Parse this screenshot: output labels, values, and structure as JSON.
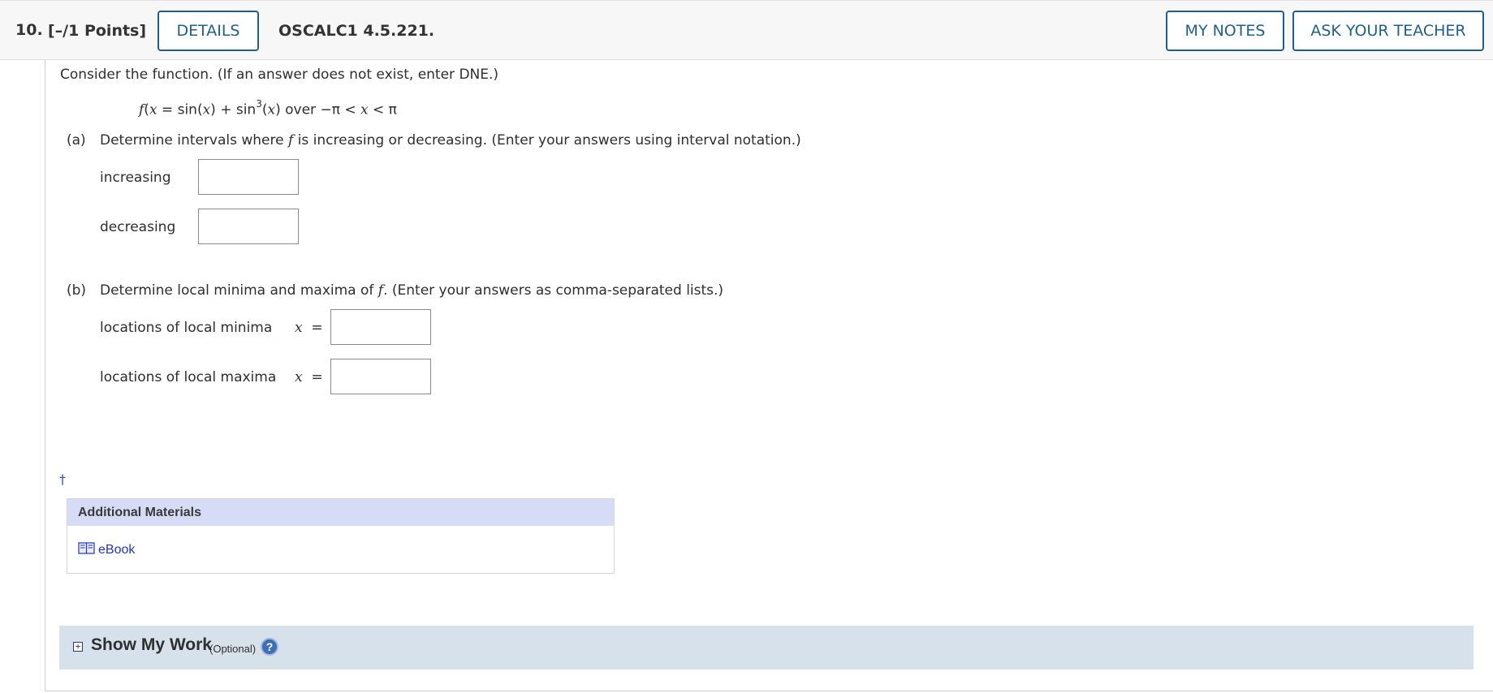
{
  "header": {
    "question_number": "10.",
    "points": "[–/1 Points]",
    "details_label": "DETAILS",
    "problem_code": "OSCALC1 4.5.221.",
    "my_notes_label": "MY NOTES",
    "ask_teacher_label": "ASK YOUR TEACHER"
  },
  "problem": {
    "intro": "Consider the function. (If an answer does not exist, enter DNE.)",
    "function": {
      "f": "f",
      "x1": "x",
      "eq": " = sin(",
      "x2": "x",
      "mid": ") + sin",
      "exp": "3",
      "paren_open": "(",
      "x3": "x",
      "over": ") over −π < ",
      "x4": "x",
      "end": " < π"
    }
  },
  "part_a": {
    "label": "(a)",
    "instruction_pre": "Determine intervals where ",
    "instruction_f": "f",
    "instruction_post": " is increasing or decreasing. (Enter your answers using interval notation.)",
    "increasing_label": "increasing",
    "increasing_value": "",
    "decreasing_label": "decreasing",
    "decreasing_value": ""
  },
  "part_b": {
    "label": "(b)",
    "instruction_pre": "Determine local minima and maxima of ",
    "instruction_f": "f",
    "instruction_post": ". (Enter your answers as comma-separated lists.)",
    "minima_label": "locations of local minima",
    "maxima_label": "locations of local maxima",
    "x_var": "x",
    "equals": "=",
    "minima_value": "",
    "maxima_value": ""
  },
  "dagger": "†",
  "additional_materials": {
    "title": "Additional Materials",
    "ebook_label": "eBook",
    "ebook_icon": "book-icon"
  },
  "show_my_work": {
    "title": "Show My Work",
    "optional": "(Optional)",
    "expand_icon": "plus-box-icon",
    "help_icon": "question-circle-icon",
    "help_glyph": "?"
  },
  "colors": {
    "button_border": "#1f5f8b",
    "link": "#2533c4",
    "materials_header_bg": "#d6dcf5",
    "show_work_bg": "#d6e1ec"
  }
}
